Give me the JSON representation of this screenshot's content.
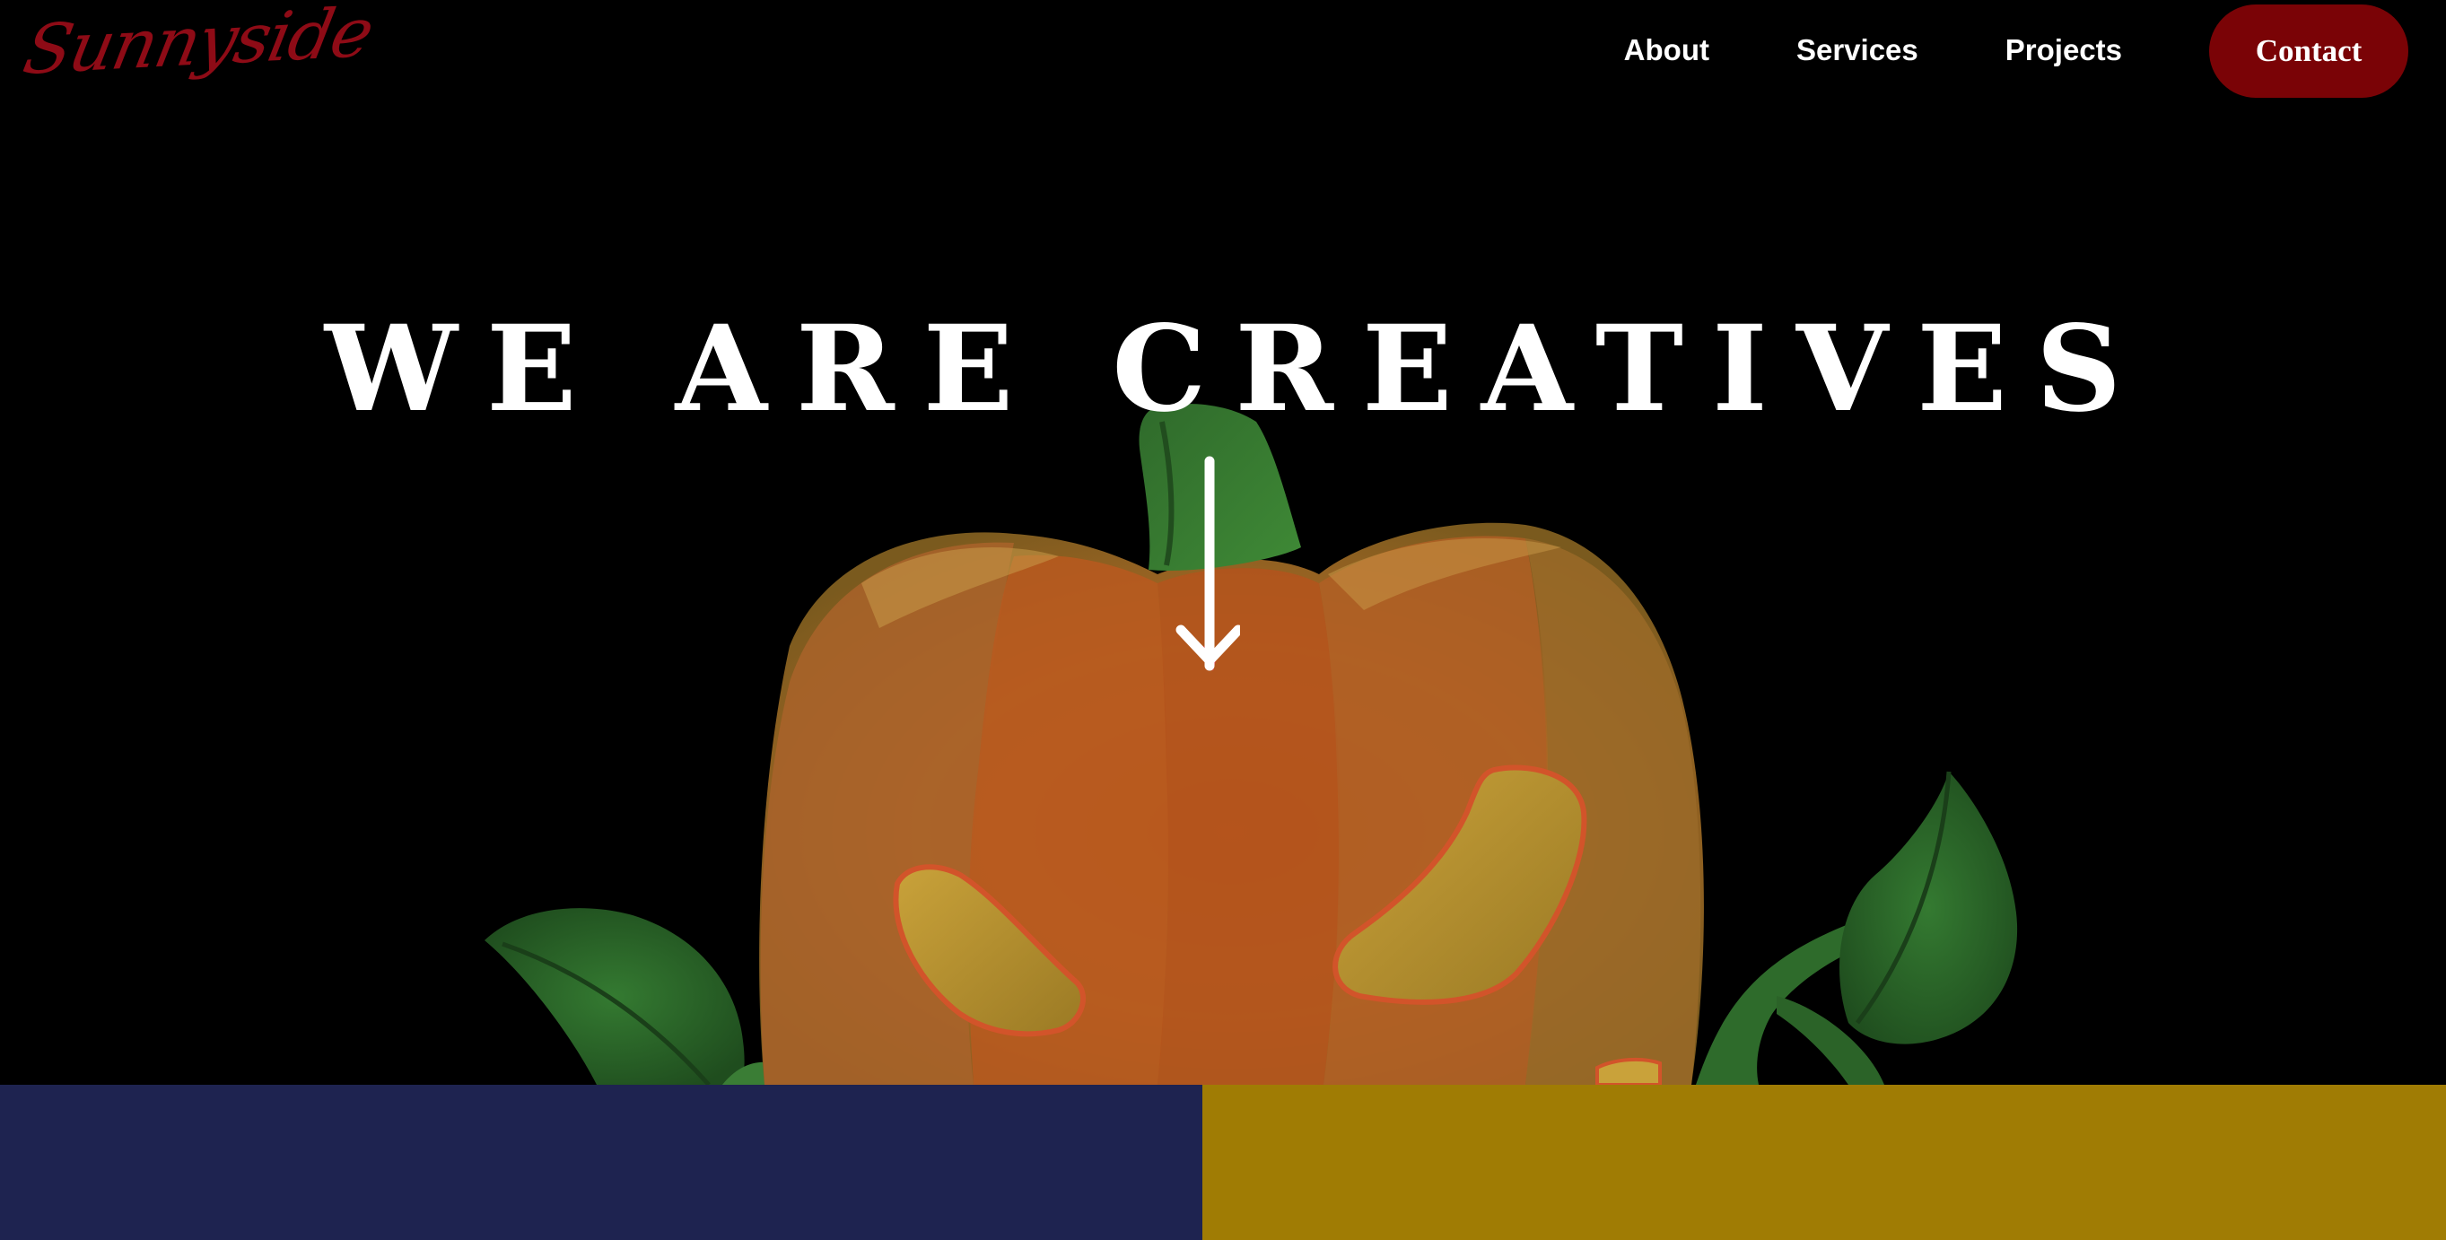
{
  "brand": {
    "logo_text": "Sunnyside"
  },
  "nav": {
    "links": [
      {
        "label": "About"
      },
      {
        "label": "Services"
      },
      {
        "label": "Projects"
      }
    ],
    "contact_label": "Contact"
  },
  "hero": {
    "title": "WE ARE CREATIVES",
    "image": "pumpkin-illustration",
    "scroll_icon": "arrow-down-icon"
  },
  "colors": {
    "background": "#000000",
    "brand": "#8e0b16",
    "contact_button": "#7a0306",
    "panel_left": "#1e2350",
    "panel_right": "#a07c04",
    "pumpkin": "#c1691f",
    "leaf": "#2e6b2b"
  }
}
